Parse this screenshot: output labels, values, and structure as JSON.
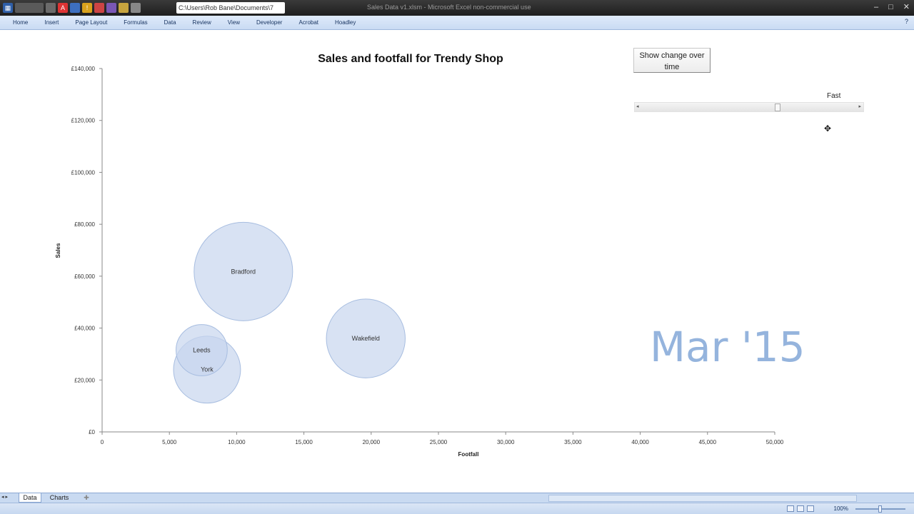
{
  "titlebar": {
    "path": "C:\\Users\\Rob Bane\\Documents\\7",
    "window_title": "Sales Data v1.xlsm - Microsoft Excel non-commercial use",
    "minimize": "–",
    "maximize": "□",
    "close": "✕"
  },
  "ribbon": {
    "tabs": [
      "Home",
      "Insert",
      "Page Layout",
      "Formulas",
      "Data",
      "Review",
      "View",
      "Developer",
      "Acrobat",
      "Hoadley"
    ],
    "help": "?"
  },
  "controls": {
    "button_label": "Show change over time",
    "fast_label": "Fast"
  },
  "month_label": "Mar '15",
  "chart_data": {
    "type": "bubble",
    "title": "Sales and footfall for Trendy Shop",
    "xlabel": "Footfall",
    "ylabel": "Sales",
    "xlim": [
      0,
      50000
    ],
    "ylim": [
      0,
      140000
    ],
    "x_ticks": [
      "0",
      "5,000",
      "10,000",
      "15,000",
      "20,000",
      "25,000",
      "30,000",
      "35,000",
      "40,000",
      "45,000",
      "50,000"
    ],
    "y_ticks": [
      "£0",
      "£20,000",
      "£40,000",
      "£60,000",
      "£80,000",
      "£100,000",
      "£120,000",
      "£140,000"
    ],
    "bubble_color": "#c7d6ee",
    "bubble_edge": "#a7bde0",
    "series": [
      {
        "name": "Bradford",
        "x": 10500,
        "y": 61800,
        "size": 1.0
      },
      {
        "name": "Wakefield",
        "x": 19600,
        "y": 36000,
        "size": 0.8
      },
      {
        "name": "York",
        "x": 7800,
        "y": 24000,
        "size": 0.68
      },
      {
        "name": "Leeds",
        "x": 7400,
        "y": 31500,
        "size": 0.52
      }
    ]
  },
  "sheets": {
    "tabs": [
      "Data",
      "Charts"
    ],
    "active": "Data"
  },
  "status": {
    "zoom": "100%"
  }
}
